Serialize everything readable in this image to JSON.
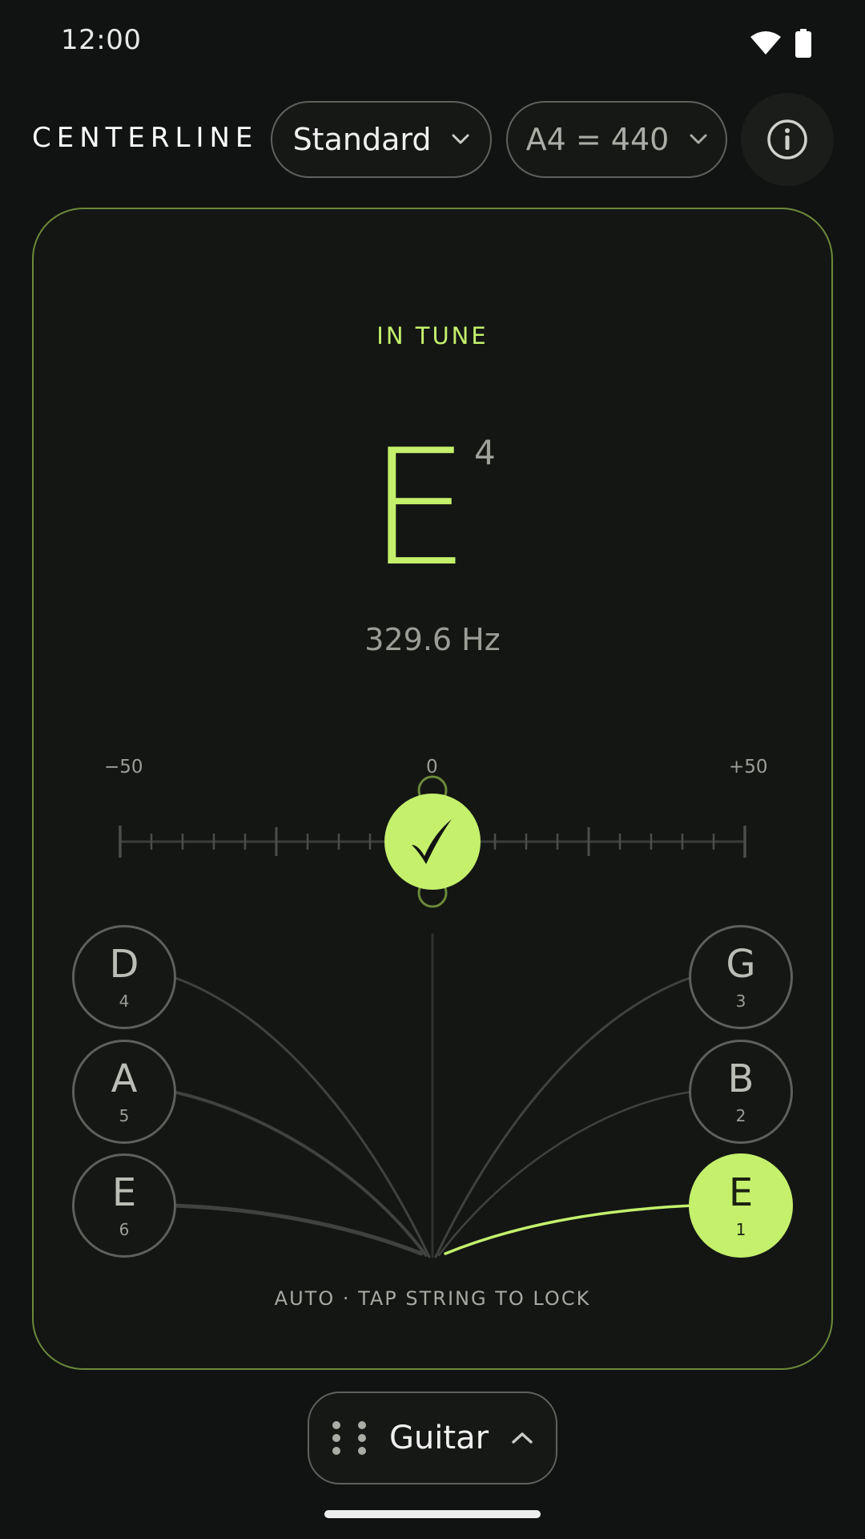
{
  "status_bar": {
    "time": "12:00",
    "icons": [
      "wifi-icon",
      "battery-icon"
    ]
  },
  "header": {
    "brand": "CENTERLINE",
    "tuning": "Standard",
    "reference": "A4 = 440",
    "info_icon": "info-icon"
  },
  "tuner": {
    "state": "IN TUNE",
    "note": "E",
    "octave": "4",
    "frequency": "329.6 Hz",
    "meter": {
      "min_label": "−50",
      "center_label": "0",
      "max_label": "+50",
      "cents": 0,
      "indicator_icon": "check-icon"
    },
    "strings": [
      {
        "note": "D",
        "number": "4",
        "active": false
      },
      {
        "note": "A",
        "number": "5",
        "active": false
      },
      {
        "note": "E",
        "number": "6",
        "active": false
      },
      {
        "note": "G",
        "number": "3",
        "active": false
      },
      {
        "note": "B",
        "number": "2",
        "active": false
      },
      {
        "note": "E",
        "number": "1",
        "active": true
      }
    ],
    "helper_text": "AUTO · TAP STRING TO LOCK"
  },
  "instrument": {
    "label": "Guitar",
    "handle_icon": "drag-handle-icon",
    "chevron_icon": "chevron-up-icon"
  },
  "colors": {
    "accent": "#c4f06c",
    "background": "#111312",
    "card_border": "#6b8a3a",
    "muted": "#5d605b"
  }
}
